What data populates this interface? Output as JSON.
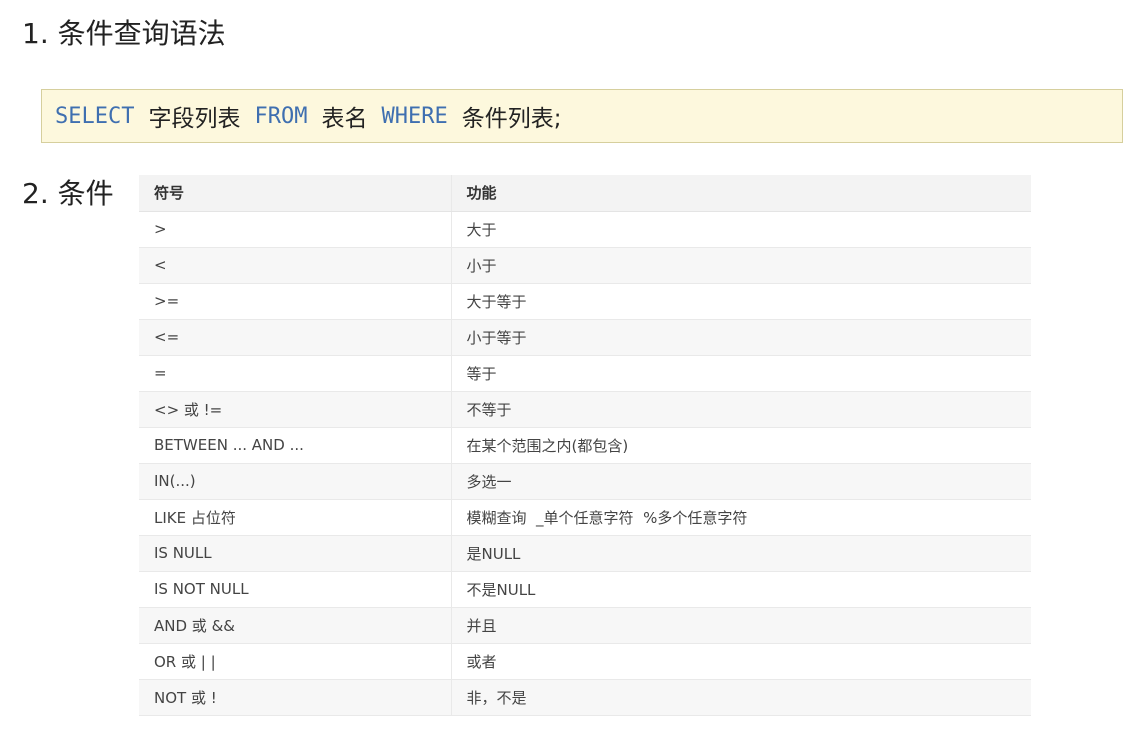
{
  "section1": {
    "title": "1. 条件查询语法"
  },
  "code": {
    "kw_select": "SELECT",
    "fields": "字段列表",
    "kw_from": "FROM",
    "table": "表名",
    "kw_where": "WHERE",
    "conditions": "条件列表;"
  },
  "section2": {
    "title": "2. 条件"
  },
  "table": {
    "headers": [
      "符号",
      "功能"
    ],
    "rows": [
      [
        ">",
        "大于"
      ],
      [
        "<",
        "小于"
      ],
      [
        ">=",
        "大于等于"
      ],
      [
        "<=",
        "小于等于"
      ],
      [
        "=",
        "等于"
      ],
      [
        "<> 或 !=",
        "不等于"
      ],
      [
        "BETWEEN ... AND ...",
        "在某个范围之内(都包含)"
      ],
      [
        "IN(...)",
        "多选一"
      ],
      [
        "LIKE 占位符",
        "模糊查询  _单个任意字符  %多个任意字符"
      ],
      [
        "IS NULL",
        "是NULL"
      ],
      [
        "IS NOT NULL",
        "不是NULL"
      ],
      [
        "AND 或 &&",
        "并且"
      ],
      [
        "OR 或 | |",
        "或者"
      ],
      [
        "NOT 或 !",
        "非，不是"
      ]
    ]
  },
  "colors": {
    "keyword": "#3f6fb0",
    "code_background": "#fdf8dd",
    "code_border": "#d6cf9d",
    "header_background": "#f3f3f3",
    "stripe_background": "#f7f7f7"
  }
}
